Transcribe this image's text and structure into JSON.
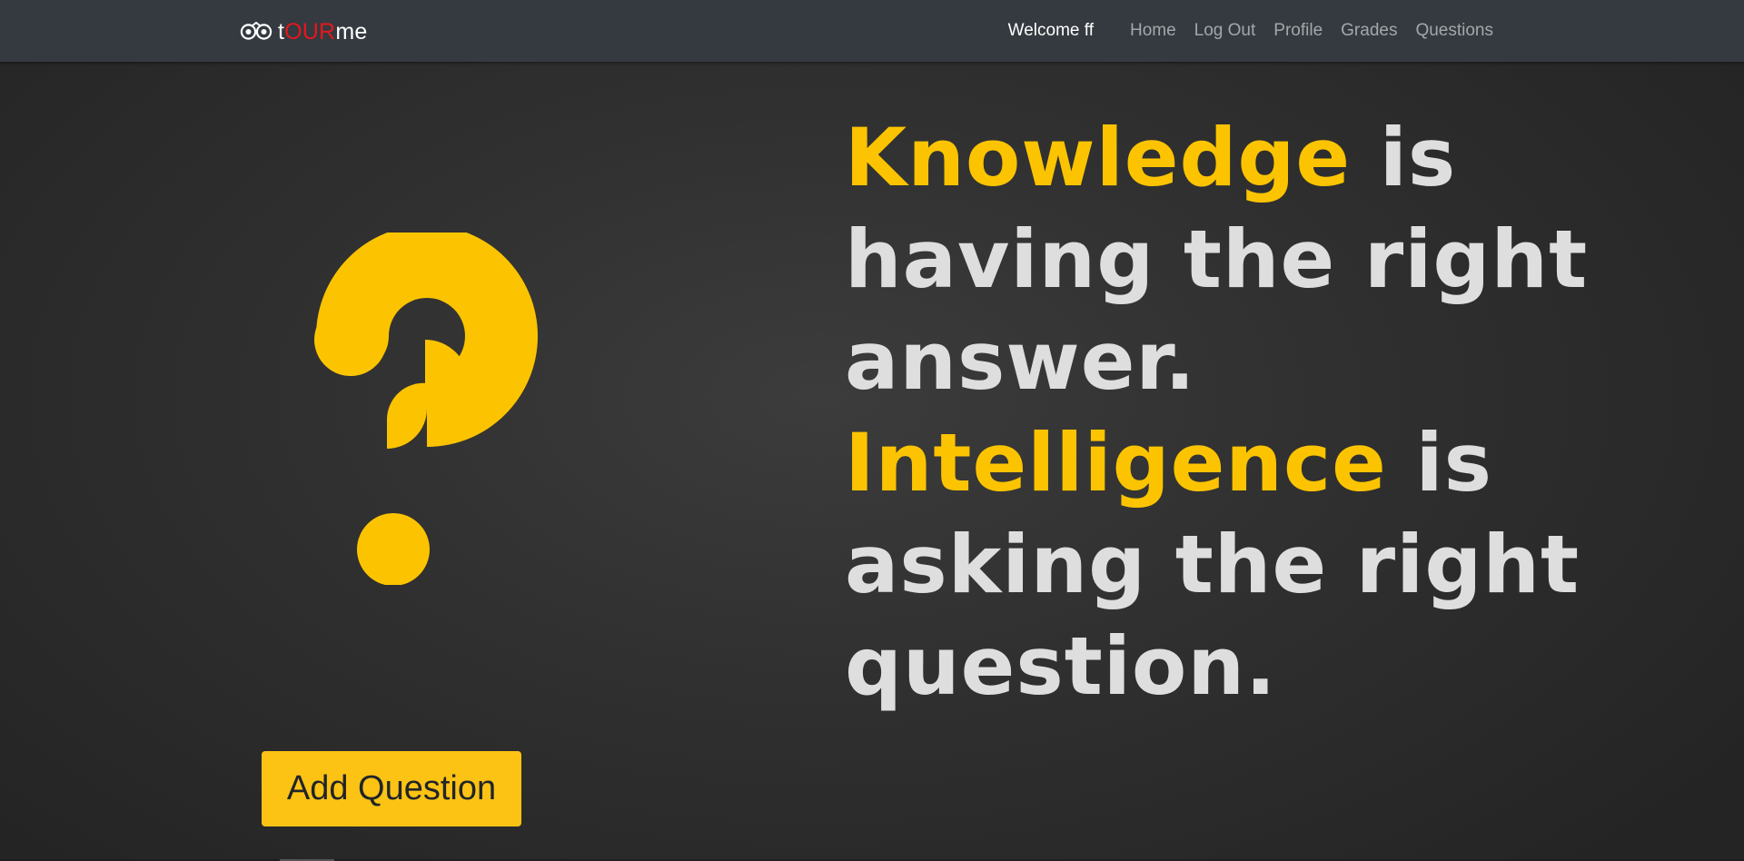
{
  "navbar": {
    "brand": {
      "icon": "owl-eyes-icon",
      "prefix": "t",
      "accent": "OUR",
      "suffix": "me",
      "accent_color": "#e3181d"
    },
    "welcome": "Welcome ff",
    "links": [
      {
        "label": "Home"
      },
      {
        "label": "Log Out"
      },
      {
        "label": "Profile"
      },
      {
        "label": "Grades"
      },
      {
        "label": "Questions"
      }
    ]
  },
  "hero": {
    "icon": "question-mark-icon",
    "icon_color": "#fcc400",
    "quote": {
      "word1": "Knowledge",
      "part1": " is\nhaving the right\nanswer.\n",
      "word2": "Intelligence",
      "part2": " is\nasking the right\nquestion."
    }
  },
  "actions": {
    "add_question_label": "Add Question",
    "button_color": "#fdc314"
  }
}
